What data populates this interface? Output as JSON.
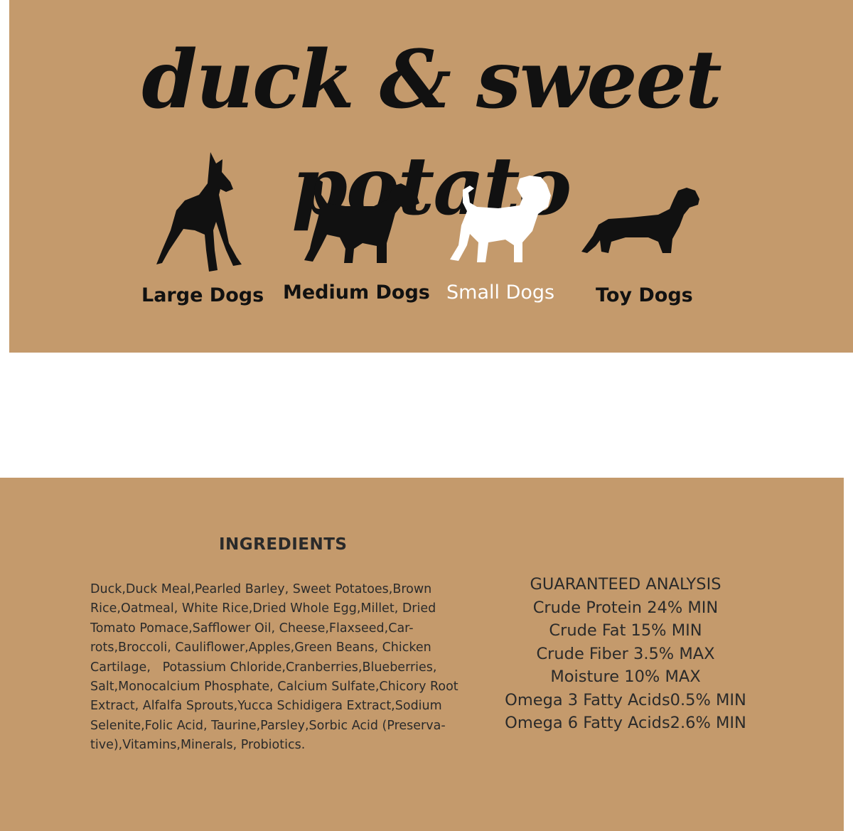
{
  "product": {
    "title": "duck & sweet potato"
  },
  "dog_sizes": [
    {
      "label": "Large Dogs",
      "icon": "large-dog-icon",
      "selected": false
    },
    {
      "label": "Medium Dogs",
      "icon": "medium-dog-icon",
      "selected": false
    },
    {
      "label": "Small Dogs",
      "icon": "small-dog-icon",
      "selected": true
    },
    {
      "label": "Toy Dogs",
      "icon": "toy-dog-icon",
      "selected": false
    }
  ],
  "ingredients": {
    "heading": "INGREDIENTS",
    "lines": [
      "Duck,Duck Meal,Pearled Barley, Sweet Potatoes,Brown",
      "Rice,Oatmeal, White Rice,Dried Whole Egg,Millet, Dried",
      "Tomato Pomace,Safflower Oil, Cheese,Flaxseed,Car-",
      "rots,Broccoli, Cauliflower,Apples,Green Beans, Chicken",
      "Cartilage,   Potassium Chloride,Cranberries,Blueberries,",
      "Salt,Monocalcium Phosphate, Calcium Sulfate,Chicory Root",
      "Extract, Alfalfa Sprouts,Yucca Schidigera Extract,Sodium",
      "Selenite,Folic Acid, Taurine,Parsley,Sorbic Acid (Preserva-",
      "tive),Vitamins,Minerals, Probiotics."
    ]
  },
  "guaranteed_analysis": {
    "heading": "GUARANTEED ANALYSIS",
    "items": [
      "Crude Protein 24% MIN",
      "Crude Fat 15% MIN",
      "Crude Fiber 3.5% MAX",
      "Moisture 10% MAX",
      "Omega 3 Fatty Acids0.5% MIN",
      "Omega 6 Fatty Acids2.6% MIN"
    ]
  },
  "colors": {
    "kraft_background": "#c49a6c",
    "silhouette": "#111111",
    "selected": "#ffffff",
    "body_text": "#2a2a2a"
  }
}
